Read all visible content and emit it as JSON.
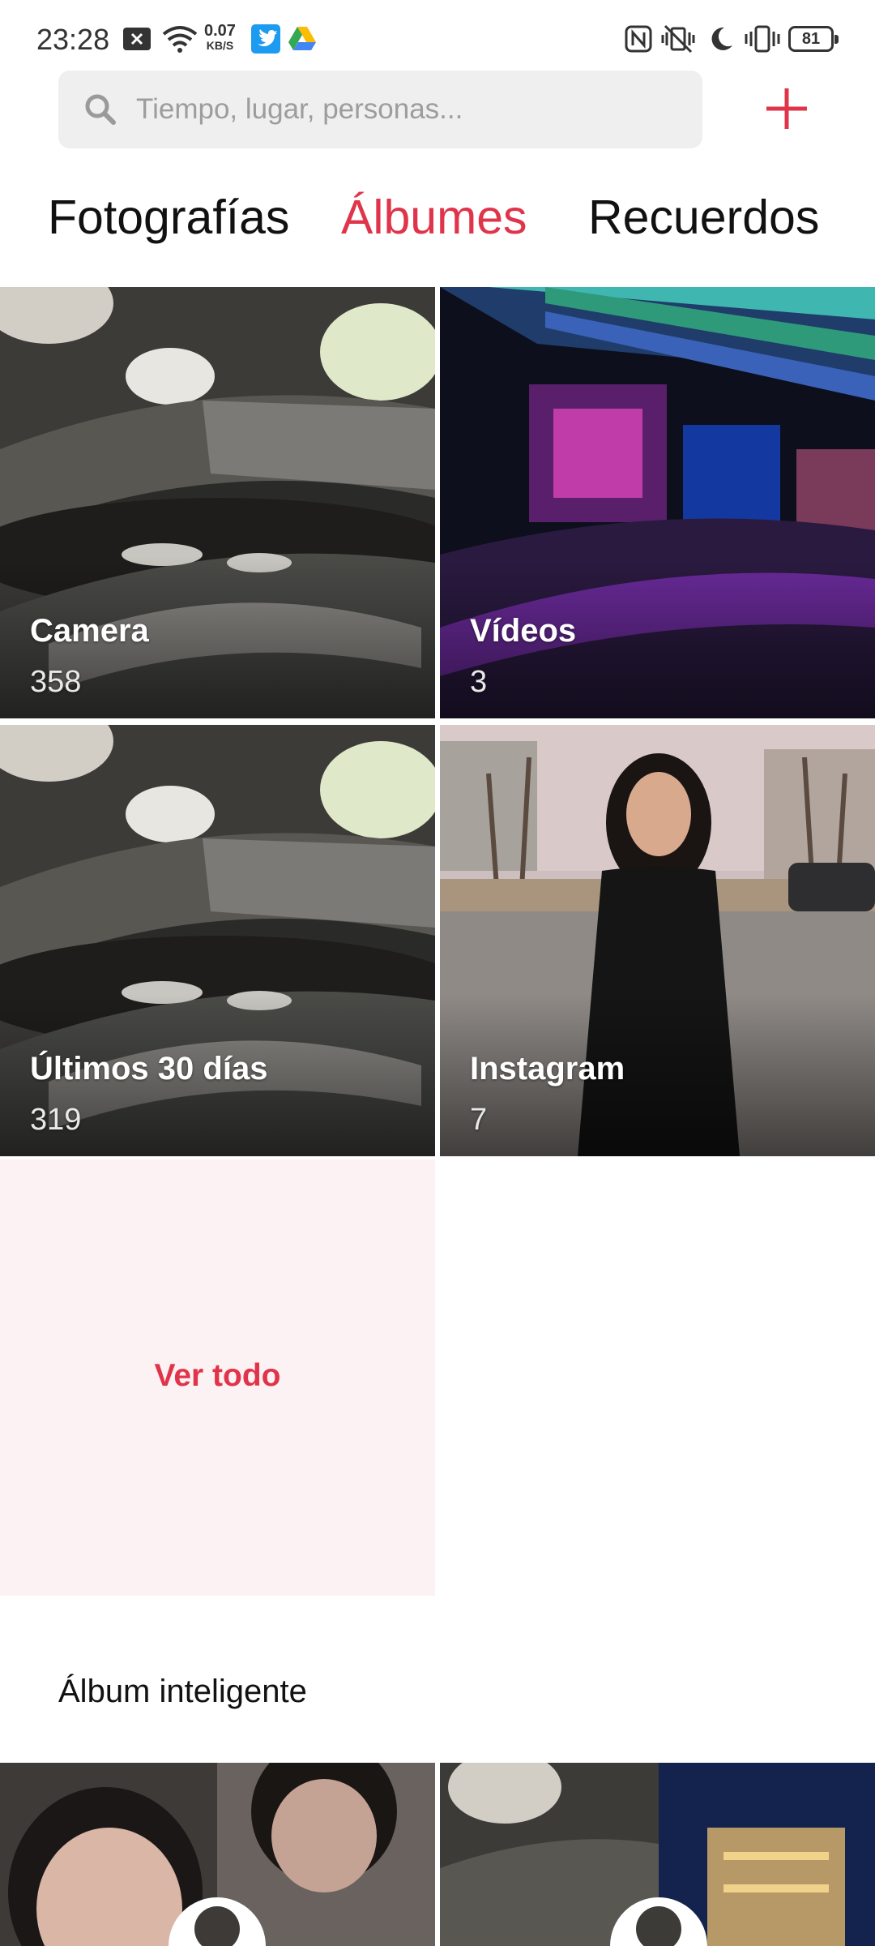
{
  "status_bar": {
    "time": "23:28",
    "net_speed_value": "0.07",
    "net_speed_unit": "KB/S",
    "battery": "81",
    "left_icons": [
      "notification-x-icon",
      "wifi-icon",
      "twitter-icon",
      "google-drive-icon"
    ],
    "right_icons": [
      "nfc-icon",
      "vibrate-off-icon",
      "moon-icon",
      "vibrate-icon",
      "battery-icon"
    ]
  },
  "search": {
    "placeholder": "Tiempo, lugar, personas...",
    "value": ""
  },
  "accent_color": "#e0344a",
  "tabs": [
    {
      "label": "Fotografías",
      "active": false
    },
    {
      "label": "Álbumes",
      "active": true
    },
    {
      "label": "Recuerdos",
      "active": false
    }
  ],
  "albums": [
    {
      "name": "Camera",
      "count": "358"
    },
    {
      "name": "Vídeos",
      "count": "3"
    },
    {
      "name": "Últimos 30 días",
      "count": "319"
    },
    {
      "name": "Instagram",
      "count": "7"
    }
  ],
  "view_all_label": "Ver todo",
  "smart_album_title": "Álbum inteligente"
}
